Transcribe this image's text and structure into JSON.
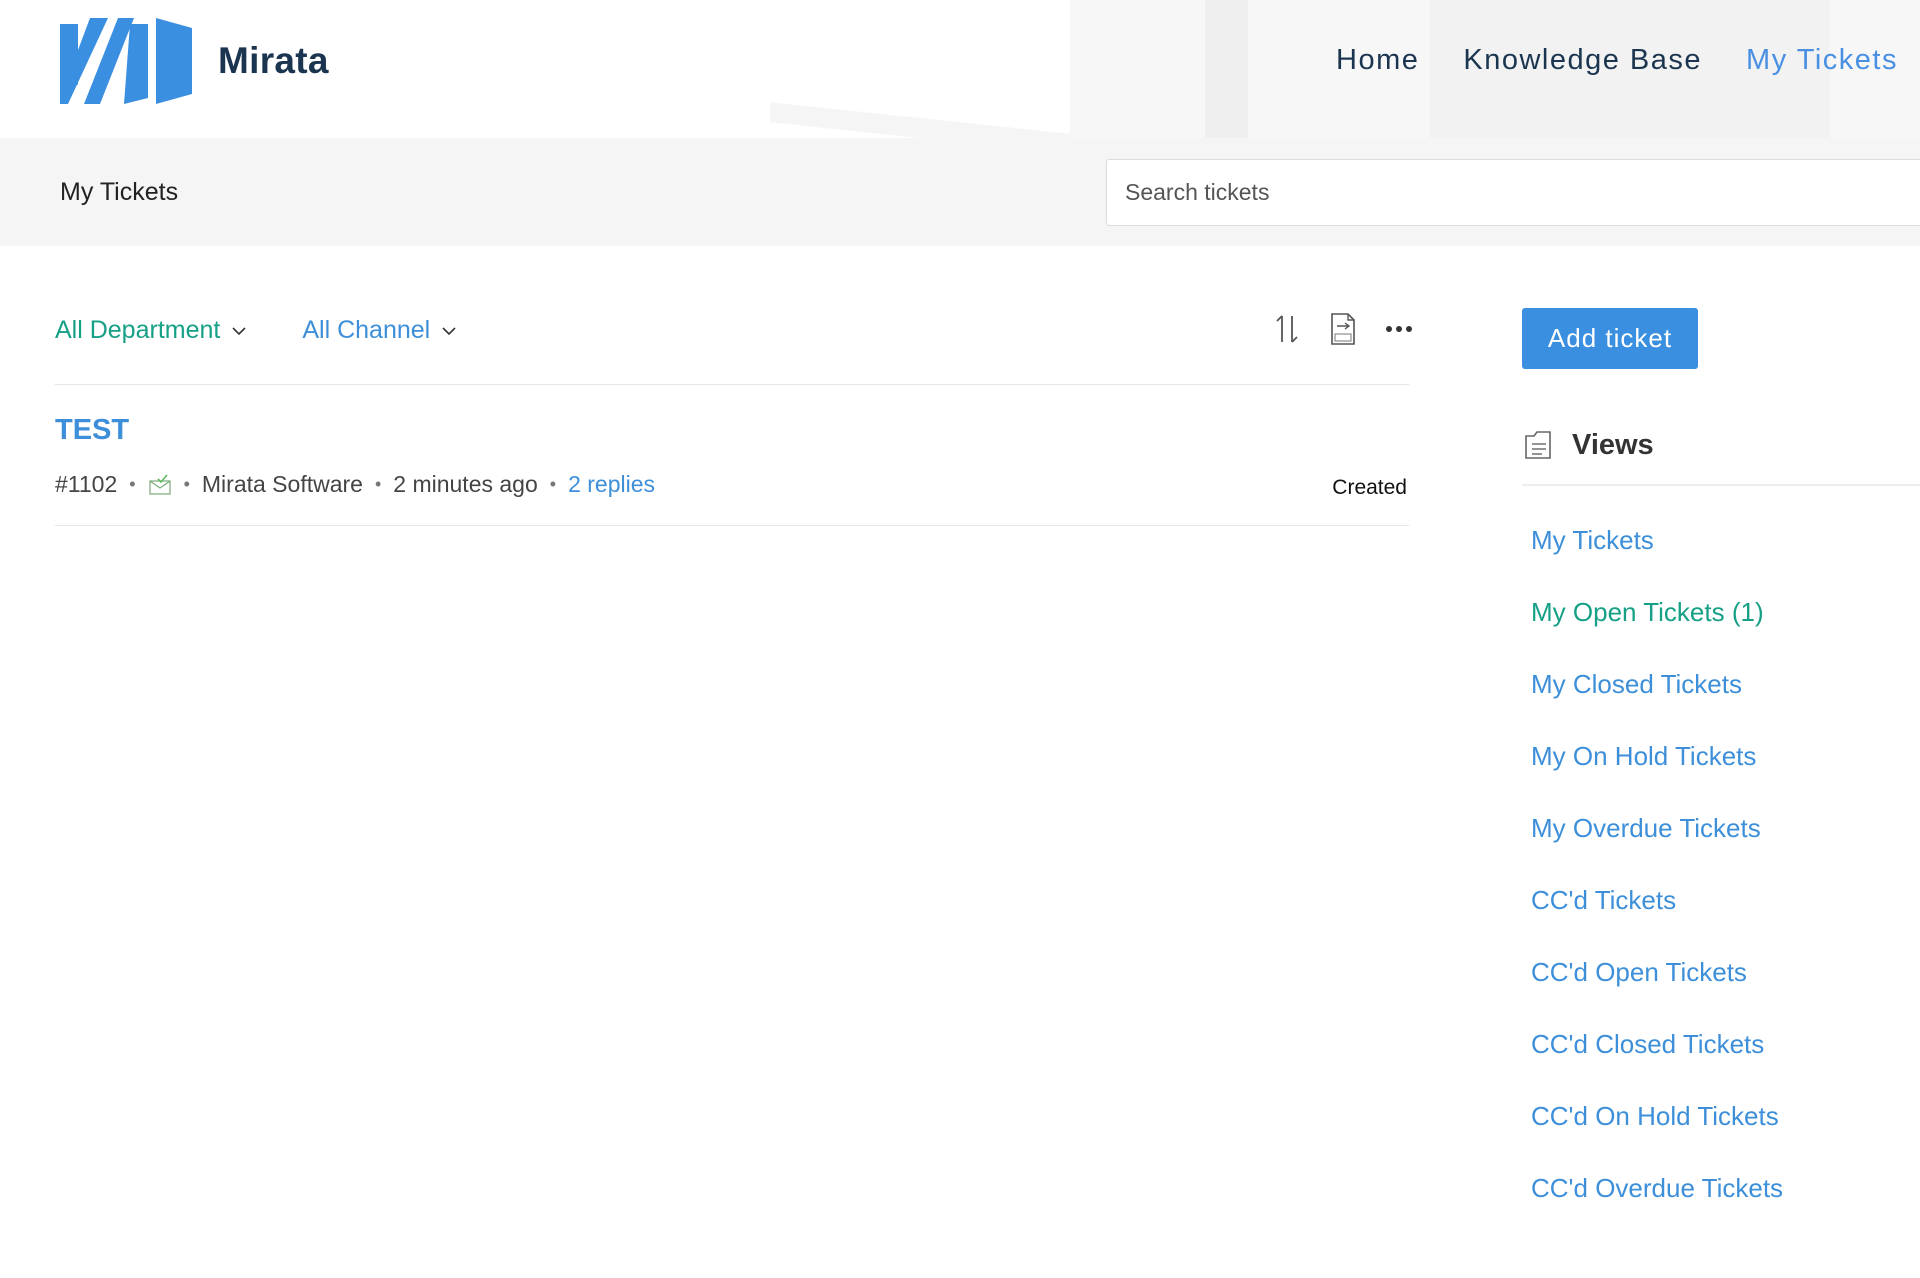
{
  "brand": {
    "name": "Mirata"
  },
  "nav": {
    "items": [
      {
        "label": "Home"
      },
      {
        "label": "Knowledge Base"
      },
      {
        "label": "My Tickets"
      }
    ]
  },
  "subheader": {
    "title": "My Tickets",
    "search_placeholder": "Search tickets"
  },
  "filters": {
    "department": "All Department",
    "channel": "All Channel"
  },
  "toolbar": {
    "icons": [
      "sort-icon",
      "csv-export-icon",
      "more-options-icon"
    ]
  },
  "tickets": [
    {
      "title": "TEST",
      "number": "#1102",
      "channel_icon": "email-icon",
      "company": "Mirata Software",
      "time": "2 minutes ago",
      "replies": "2 replies",
      "status": "Created"
    }
  ],
  "sidebar": {
    "add_ticket_label": "Add ticket",
    "views_title": "Views",
    "views": [
      {
        "label": "My Tickets"
      },
      {
        "label": "My Open Tickets (1)"
      },
      {
        "label": "My Closed Tickets"
      },
      {
        "label": "My On Hold Tickets"
      },
      {
        "label": "My Overdue Tickets"
      },
      {
        "label": "CC'd Tickets"
      },
      {
        "label": "CC'd Open Tickets"
      },
      {
        "label": "CC'd Closed Tickets"
      },
      {
        "label": "CC'd On Hold Tickets"
      },
      {
        "label": "CC'd Overdue Tickets"
      }
    ]
  },
  "colors": {
    "brand_dark": "#1b3550",
    "link_blue": "#3d8fd9",
    "accent_green": "#16a086",
    "button_blue": "#3b8fe0"
  }
}
